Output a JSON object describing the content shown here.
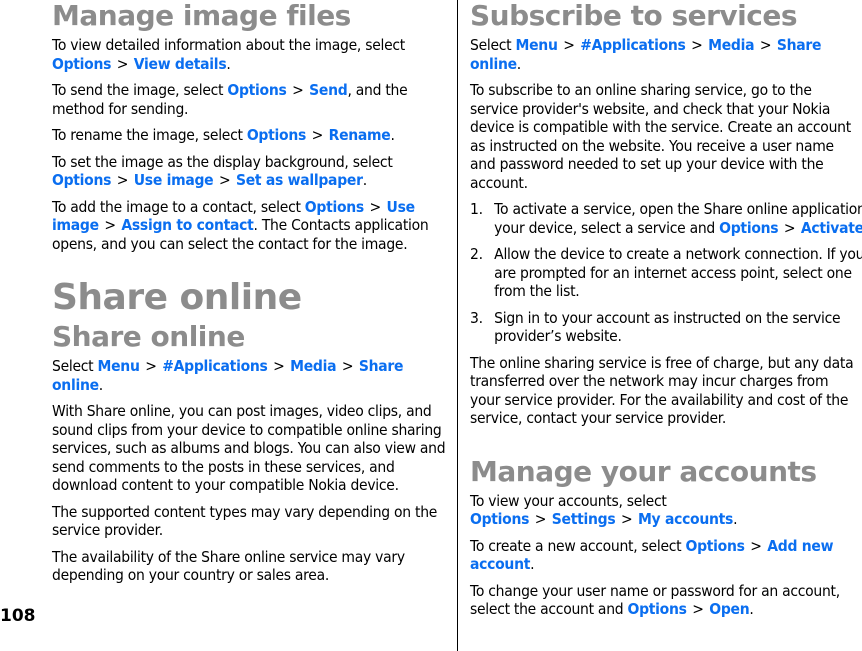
{
  "page_number": "108",
  "colors": {
    "link": "#0a6ef0",
    "heading": "#8c8c8c",
    "divider": "#000000"
  },
  "left": {
    "manage_image_files": {
      "title": "Manage image files",
      "p1": {
        "text": "To view detailed information about the image, select ",
        "path": [
          "Options",
          "View details"
        ],
        "end": "."
      },
      "p2": {
        "text": "To send the image, select ",
        "path": [
          "Options",
          "Send"
        ],
        "end": ", and the method for sending."
      },
      "p3": {
        "text": "To rename the image, select ",
        "path": [
          "Options",
          "Rename"
        ],
        "end": "."
      },
      "p4": {
        "text": "To set the image as the display background, select ",
        "path": [
          "Options",
          "Use image",
          "Set as wallpaper"
        ],
        "end": "."
      },
      "p5": {
        "text": "To add the image to a contact, select ",
        "path": [
          "Options",
          "Use image",
          "Assign to contact"
        ],
        "end": ". The Contacts application opens, and you can select the contact for the image."
      }
    },
    "share_online": {
      "chapter_title": "Share online",
      "section_title": "Share online",
      "p1": {
        "text": "Select ",
        "path": [
          "Menu",
          "#Applications",
          "Media",
          "Share online"
        ],
        "end": "."
      },
      "p2": "With Share online, you can post images, video clips, and sound clips from your device to compatible online sharing services, such as albums and blogs. You can also view and send comments to the posts in these services, and download content to your compatible Nokia device.",
      "p3": "The supported content types may vary depending on the service provider.",
      "p4": "The availability of the Share online service may vary depending on your country or sales area."
    }
  },
  "right": {
    "subscribe": {
      "title": "Subscribe to services",
      "p1": {
        "text": "Select ",
        "path": [
          "Menu",
          "#Applications",
          "Media",
          "Share online"
        ],
        "end": "."
      },
      "p2": "To subscribe to an online sharing service, go to the service provider's website, and check that your Nokia device is compatible with the service. Create an account as instructed on the website. You receive a user name and password needed to set up your device with the account.",
      "steps": [
        {
          "num": "1.",
          "text": "To activate a service, open the Share online application in your device, select a service and ",
          "path": [
            "Options",
            "Activate"
          ],
          "end": "."
        },
        {
          "num": "2.",
          "text": "Allow the device to create a network connection. If you are prompted for an internet access point, select one from the list.",
          "path": [],
          "end": ""
        },
        {
          "num": "3.",
          "text": "Sign in to your account as instructed on the service provider’s website.",
          "path": [],
          "end": ""
        }
      ],
      "p3": "The online sharing service is free of charge, but any data transferred over the network may incur charges from your service provider. For the availability and cost of the service, contact your service provider."
    },
    "manage_accounts": {
      "title": "Manage your accounts",
      "p1": {
        "text": "To view your accounts, select ",
        "path": [
          "Options",
          "Settings",
          "My accounts"
        ],
        "end": "."
      },
      "p2": {
        "text": "To create a new account, select ",
        "path": [
          "Options",
          "Add new account"
        ],
        "end": "."
      },
      "p3": {
        "text": "To change your user name or password for an account, select the account and ",
        "path": [
          "Options",
          "Open"
        ],
        "end": "."
      }
    }
  }
}
